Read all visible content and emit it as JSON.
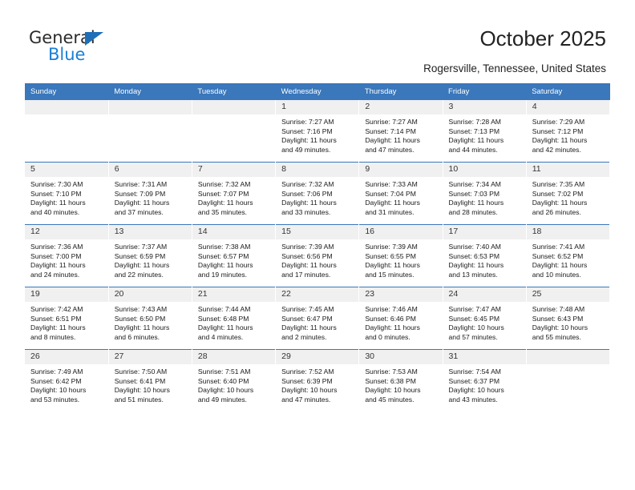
{
  "brand": {
    "name_part1": "General",
    "name_part2": "Blue",
    "triangle_color": "#1e6fb8",
    "blue_color": "#1a7fd4"
  },
  "header": {
    "title": "October 2025",
    "subtitle": "Rogersville, Tennessee, United States",
    "header_bg": "#3a77bb"
  },
  "weekdays": [
    "Sunday",
    "Monday",
    "Tuesday",
    "Wednesday",
    "Thursday",
    "Friday",
    "Saturday"
  ],
  "labels": {
    "sunrise_prefix": "Sunrise: ",
    "sunset_prefix": "Sunset: ",
    "daylight_prefix": "Daylight: "
  },
  "weeks": [
    [
      {
        "day": "",
        "empty": true
      },
      {
        "day": "",
        "empty": true
      },
      {
        "day": "",
        "empty": true
      },
      {
        "day": "1",
        "sunrise": "Sunrise: 7:27 AM",
        "sunset": "Sunset: 7:16 PM",
        "daylight1": "Daylight: 11 hours",
        "daylight2": "and 49 minutes."
      },
      {
        "day": "2",
        "sunrise": "Sunrise: 7:27 AM",
        "sunset": "Sunset: 7:14 PM",
        "daylight1": "Daylight: 11 hours",
        "daylight2": "and 47 minutes."
      },
      {
        "day": "3",
        "sunrise": "Sunrise: 7:28 AM",
        "sunset": "Sunset: 7:13 PM",
        "daylight1": "Daylight: 11 hours",
        "daylight2": "and 44 minutes."
      },
      {
        "day": "4",
        "sunrise": "Sunrise: 7:29 AM",
        "sunset": "Sunset: 7:12 PM",
        "daylight1": "Daylight: 11 hours",
        "daylight2": "and 42 minutes."
      }
    ],
    [
      {
        "day": "5",
        "sunrise": "Sunrise: 7:30 AM",
        "sunset": "Sunset: 7:10 PM",
        "daylight1": "Daylight: 11 hours",
        "daylight2": "and 40 minutes."
      },
      {
        "day": "6",
        "sunrise": "Sunrise: 7:31 AM",
        "sunset": "Sunset: 7:09 PM",
        "daylight1": "Daylight: 11 hours",
        "daylight2": "and 37 minutes."
      },
      {
        "day": "7",
        "sunrise": "Sunrise: 7:32 AM",
        "sunset": "Sunset: 7:07 PM",
        "daylight1": "Daylight: 11 hours",
        "daylight2": "and 35 minutes."
      },
      {
        "day": "8",
        "sunrise": "Sunrise: 7:32 AM",
        "sunset": "Sunset: 7:06 PM",
        "daylight1": "Daylight: 11 hours",
        "daylight2": "and 33 minutes."
      },
      {
        "day": "9",
        "sunrise": "Sunrise: 7:33 AM",
        "sunset": "Sunset: 7:04 PM",
        "daylight1": "Daylight: 11 hours",
        "daylight2": "and 31 minutes."
      },
      {
        "day": "10",
        "sunrise": "Sunrise: 7:34 AM",
        "sunset": "Sunset: 7:03 PM",
        "daylight1": "Daylight: 11 hours",
        "daylight2": "and 28 minutes."
      },
      {
        "day": "11",
        "sunrise": "Sunrise: 7:35 AM",
        "sunset": "Sunset: 7:02 PM",
        "daylight1": "Daylight: 11 hours",
        "daylight2": "and 26 minutes."
      }
    ],
    [
      {
        "day": "12",
        "sunrise": "Sunrise: 7:36 AM",
        "sunset": "Sunset: 7:00 PM",
        "daylight1": "Daylight: 11 hours",
        "daylight2": "and 24 minutes."
      },
      {
        "day": "13",
        "sunrise": "Sunrise: 7:37 AM",
        "sunset": "Sunset: 6:59 PM",
        "daylight1": "Daylight: 11 hours",
        "daylight2": "and 22 minutes."
      },
      {
        "day": "14",
        "sunrise": "Sunrise: 7:38 AM",
        "sunset": "Sunset: 6:57 PM",
        "daylight1": "Daylight: 11 hours",
        "daylight2": "and 19 minutes."
      },
      {
        "day": "15",
        "sunrise": "Sunrise: 7:39 AM",
        "sunset": "Sunset: 6:56 PM",
        "daylight1": "Daylight: 11 hours",
        "daylight2": "and 17 minutes."
      },
      {
        "day": "16",
        "sunrise": "Sunrise: 7:39 AM",
        "sunset": "Sunset: 6:55 PM",
        "daylight1": "Daylight: 11 hours",
        "daylight2": "and 15 minutes."
      },
      {
        "day": "17",
        "sunrise": "Sunrise: 7:40 AM",
        "sunset": "Sunset: 6:53 PM",
        "daylight1": "Daylight: 11 hours",
        "daylight2": "and 13 minutes."
      },
      {
        "day": "18",
        "sunrise": "Sunrise: 7:41 AM",
        "sunset": "Sunset: 6:52 PM",
        "daylight1": "Daylight: 11 hours",
        "daylight2": "and 10 minutes."
      }
    ],
    [
      {
        "day": "19",
        "sunrise": "Sunrise: 7:42 AM",
        "sunset": "Sunset: 6:51 PM",
        "daylight1": "Daylight: 11 hours",
        "daylight2": "and 8 minutes."
      },
      {
        "day": "20",
        "sunrise": "Sunrise: 7:43 AM",
        "sunset": "Sunset: 6:50 PM",
        "daylight1": "Daylight: 11 hours",
        "daylight2": "and 6 minutes."
      },
      {
        "day": "21",
        "sunrise": "Sunrise: 7:44 AM",
        "sunset": "Sunset: 6:48 PM",
        "daylight1": "Daylight: 11 hours",
        "daylight2": "and 4 minutes."
      },
      {
        "day": "22",
        "sunrise": "Sunrise: 7:45 AM",
        "sunset": "Sunset: 6:47 PM",
        "daylight1": "Daylight: 11 hours",
        "daylight2": "and 2 minutes."
      },
      {
        "day": "23",
        "sunrise": "Sunrise: 7:46 AM",
        "sunset": "Sunset: 6:46 PM",
        "daylight1": "Daylight: 11 hours",
        "daylight2": "and 0 minutes."
      },
      {
        "day": "24",
        "sunrise": "Sunrise: 7:47 AM",
        "sunset": "Sunset: 6:45 PM",
        "daylight1": "Daylight: 10 hours",
        "daylight2": "and 57 minutes."
      },
      {
        "day": "25",
        "sunrise": "Sunrise: 7:48 AM",
        "sunset": "Sunset: 6:43 PM",
        "daylight1": "Daylight: 10 hours",
        "daylight2": "and 55 minutes."
      }
    ],
    [
      {
        "day": "26",
        "sunrise": "Sunrise: 7:49 AM",
        "sunset": "Sunset: 6:42 PM",
        "daylight1": "Daylight: 10 hours",
        "daylight2": "and 53 minutes."
      },
      {
        "day": "27",
        "sunrise": "Sunrise: 7:50 AM",
        "sunset": "Sunset: 6:41 PM",
        "daylight1": "Daylight: 10 hours",
        "daylight2": "and 51 minutes."
      },
      {
        "day": "28",
        "sunrise": "Sunrise: 7:51 AM",
        "sunset": "Sunset: 6:40 PM",
        "daylight1": "Daylight: 10 hours",
        "daylight2": "and 49 minutes."
      },
      {
        "day": "29",
        "sunrise": "Sunrise: 7:52 AM",
        "sunset": "Sunset: 6:39 PM",
        "daylight1": "Daylight: 10 hours",
        "daylight2": "and 47 minutes."
      },
      {
        "day": "30",
        "sunrise": "Sunrise: 7:53 AM",
        "sunset": "Sunset: 6:38 PM",
        "daylight1": "Daylight: 10 hours",
        "daylight2": "and 45 minutes."
      },
      {
        "day": "31",
        "sunrise": "Sunrise: 7:54 AM",
        "sunset": "Sunset: 6:37 PM",
        "daylight1": "Daylight: 10 hours",
        "daylight2": "and 43 minutes."
      },
      {
        "day": "",
        "empty": true
      }
    ]
  ]
}
